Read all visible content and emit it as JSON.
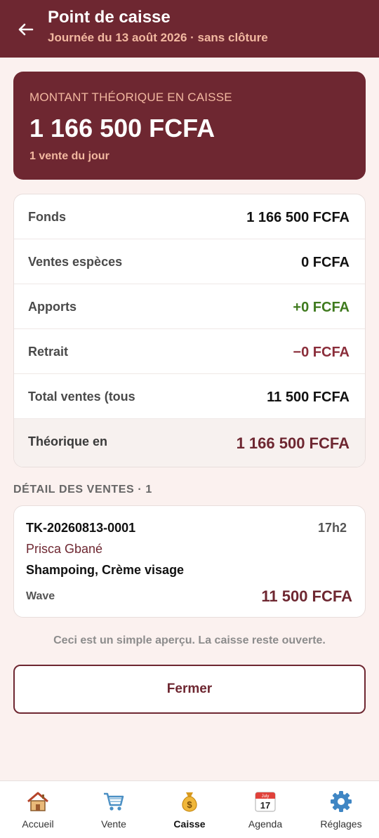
{
  "header": {
    "title": "Point de caisse",
    "subtitle": "Journée du 13 août 2026 · sans clôture"
  },
  "summary": {
    "label": "MONTANT THÉORIQUE EN CAISSE",
    "amount": "1 166 500 FCFA",
    "count": "1 vente du jour"
  },
  "breakdown": {
    "rows": [
      {
        "label": "Fonds",
        "value": "1 166 500 FCFA"
      },
      {
        "label": "Ventes espèces",
        "value": "0 FCFA"
      },
      {
        "label": "Apports",
        "value": "+0 FCFA"
      },
      {
        "label": "Retrait",
        "value": "−0 FCFA"
      },
      {
        "label": "Total ventes (tous",
        "value": "11 500 FCFA"
      }
    ],
    "total": {
      "label": "Théorique en",
      "value": "1 166 500 FCFA"
    }
  },
  "sales_section": {
    "title": "DÉTAIL DES VENTES · 1"
  },
  "sales": [
    {
      "ticket": "TK-20260813-0001",
      "time": "17h2",
      "client": "Prisca Gbané",
      "items": "Shampoing, Crème visage",
      "method": "Wave",
      "amount": "11 500 FCFA"
    }
  ],
  "note": "Ceci est un simple aperçu. La caisse reste ouverte.",
  "close_label": "Fermer",
  "nav": {
    "items": [
      {
        "label": "Accueil",
        "icon": "house-icon"
      },
      {
        "label": "Vente",
        "icon": "cart-icon"
      },
      {
        "label": "Caisse",
        "icon": "money-bag-icon"
      },
      {
        "label": "Agenda",
        "icon": "calendar-icon",
        "icon_text": {
          "month": "July",
          "day": "17"
        }
      },
      {
        "label": "Réglages",
        "icon": "gear-icon"
      }
    ],
    "active": "Caisse"
  },
  "colors": {
    "brand": "#6e2731",
    "accent_light": "#f2b8a0",
    "positive": "#3f7a1e",
    "negative": "#8a2d3a",
    "background": "#fbf1ef"
  }
}
